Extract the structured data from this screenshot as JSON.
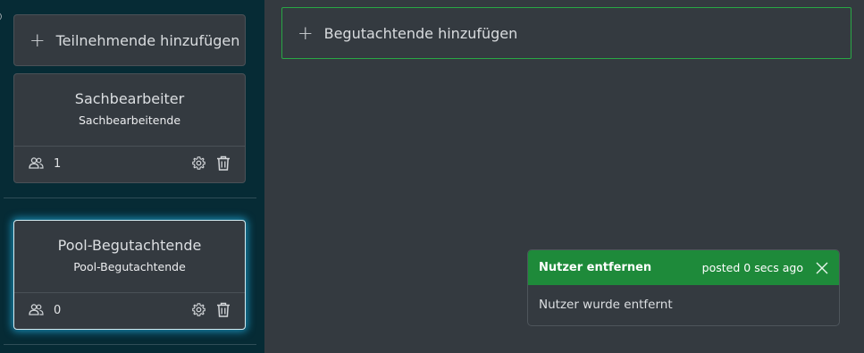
{
  "sidebar": {
    "add_participant_label": "Teilnehmende hinzufügen",
    "roles": [
      {
        "title": "Sachbearbeiter",
        "subtitle": "Sachbearbeitende",
        "member_count": "1",
        "selected": false
      },
      {
        "title": "Pool-Begutachtende",
        "subtitle": "Pool-Begutachtende",
        "member_count": "0",
        "selected": true
      }
    ]
  },
  "main": {
    "add_reviewer_label": "Begutachtende hinzufügen"
  },
  "toast": {
    "title": "Nutzer entfernen",
    "time": "posted 0 secs ago",
    "message": "Nutzer wurde entfernt"
  },
  "icons": {
    "plus": "plus-icon",
    "members": "people-icon",
    "settings": "gear-icon",
    "delete": "trash-icon",
    "close": "close-icon"
  },
  "colors": {
    "sidebar_bg": "#062b35",
    "panel_bg": "#343a40",
    "accent_green": "#1e8a3a",
    "add_reviewer_border": "#29a745",
    "selected_glow": "#20aadc"
  }
}
